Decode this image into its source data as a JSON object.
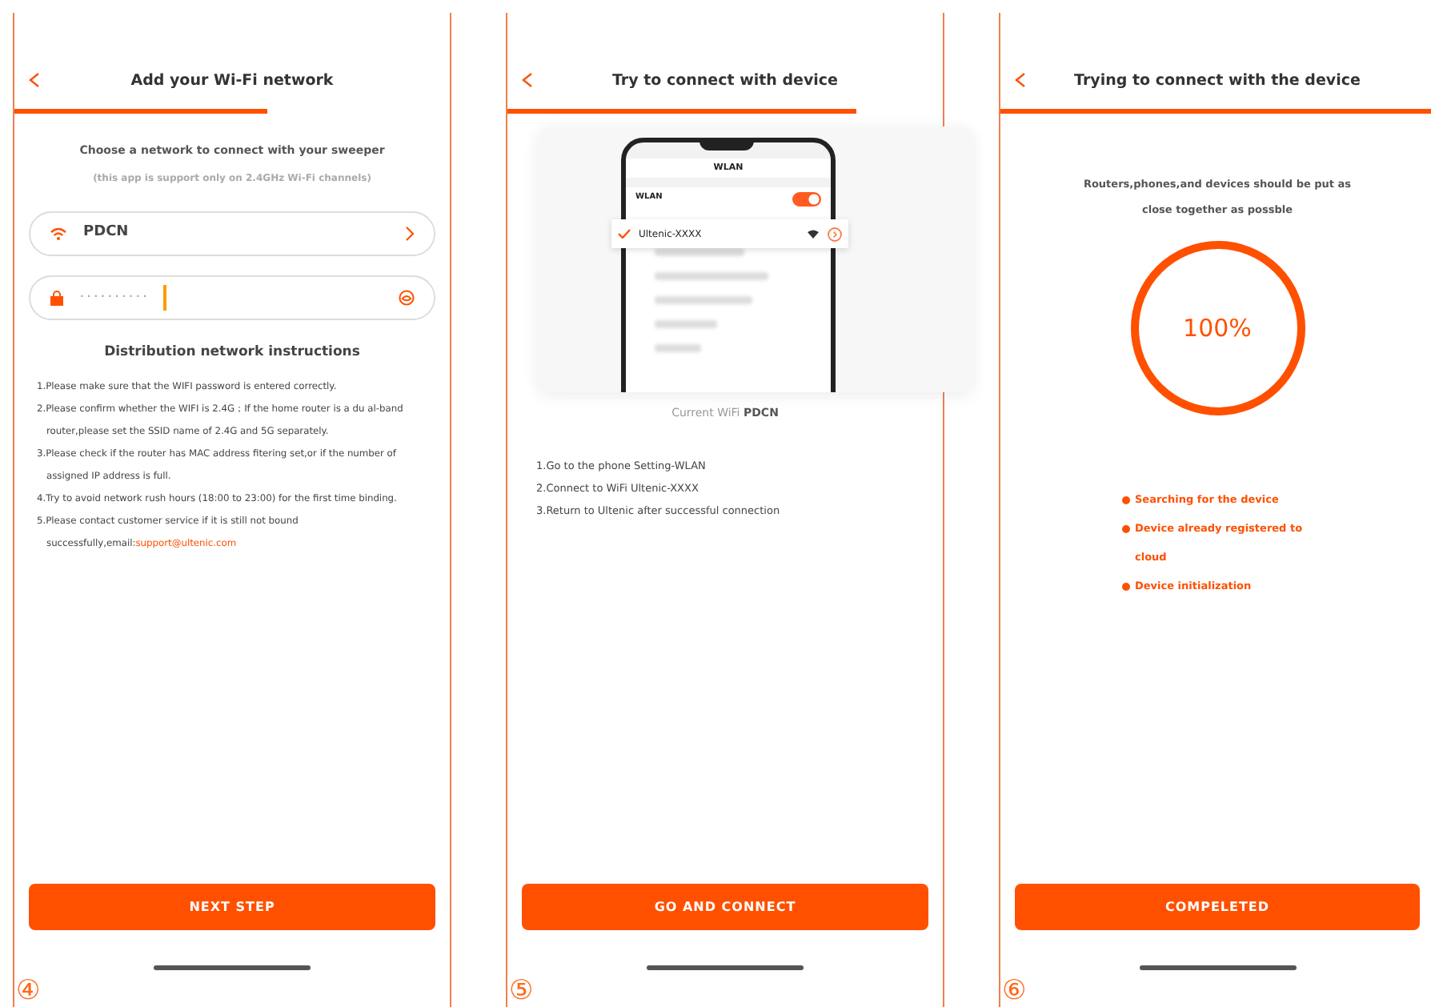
{
  "screens": [
    {
      "kind": "wifi",
      "title": "Add your Wi-Fi network",
      "subtitle": "Choose a network to connect with your sweeper",
      "note": "(this app is support only on 2.4GHz Wi-Fi channels)",
      "network": "PDCN",
      "password": "· · · · · · · · · ·",
      "instructions_title": "Distribution network instructions",
      "instructions": [
        {
          "text": "1.Please make sure that the WIFI password is entered correctly."
        },
        {
          "text": "2.Please confirm whether the WIFI is 2.4G；If the home router is a du al-band router,please set the SSID name of 2.4G and 5G separately."
        },
        {
          "text": "3.Please check if the router has MAC address fitering set,or if the number of assigned IP address is full."
        },
        {
          "text": "4.Try to avoid network rush hours (18:00 to 23:00) for the first time binding."
        },
        {
          "text": "5.Please contact customer service if it is still not bound successfully,email:",
          "link": "support@ultenic.com"
        }
      ],
      "button": "NEXT STEP",
      "step": "④"
    },
    {
      "kind": "connect",
      "title": "Try to connect with device",
      "phone": {
        "title": "WLAN",
        "toggle_label": "WLAN",
        "wlan_on": true,
        "network": "Ultenic-XXXX"
      },
      "caption": "Current WiFi **PDCN**",
      "steps": [
        "1.Go to the phone Setting-WLAN",
        "2.Connect to WiFi Ultenic-XXXX",
        "3.Return to Ultenic after successful connection"
      ],
      "button": "GO AND CONNECT",
      "step": "⑤"
    },
    {
      "kind": "progress",
      "title": "Trying to connect with the device",
      "hint": "Routers,phones,and devices should be put as close together as possble",
      "level": 1,
      "reading": "100%",
      "stages": [
        "Searching for the device",
        "Device already registered to cloud",
        "Device initialization"
      ],
      "button": "COMPELETED",
      "step": "⑥"
    }
  ]
}
